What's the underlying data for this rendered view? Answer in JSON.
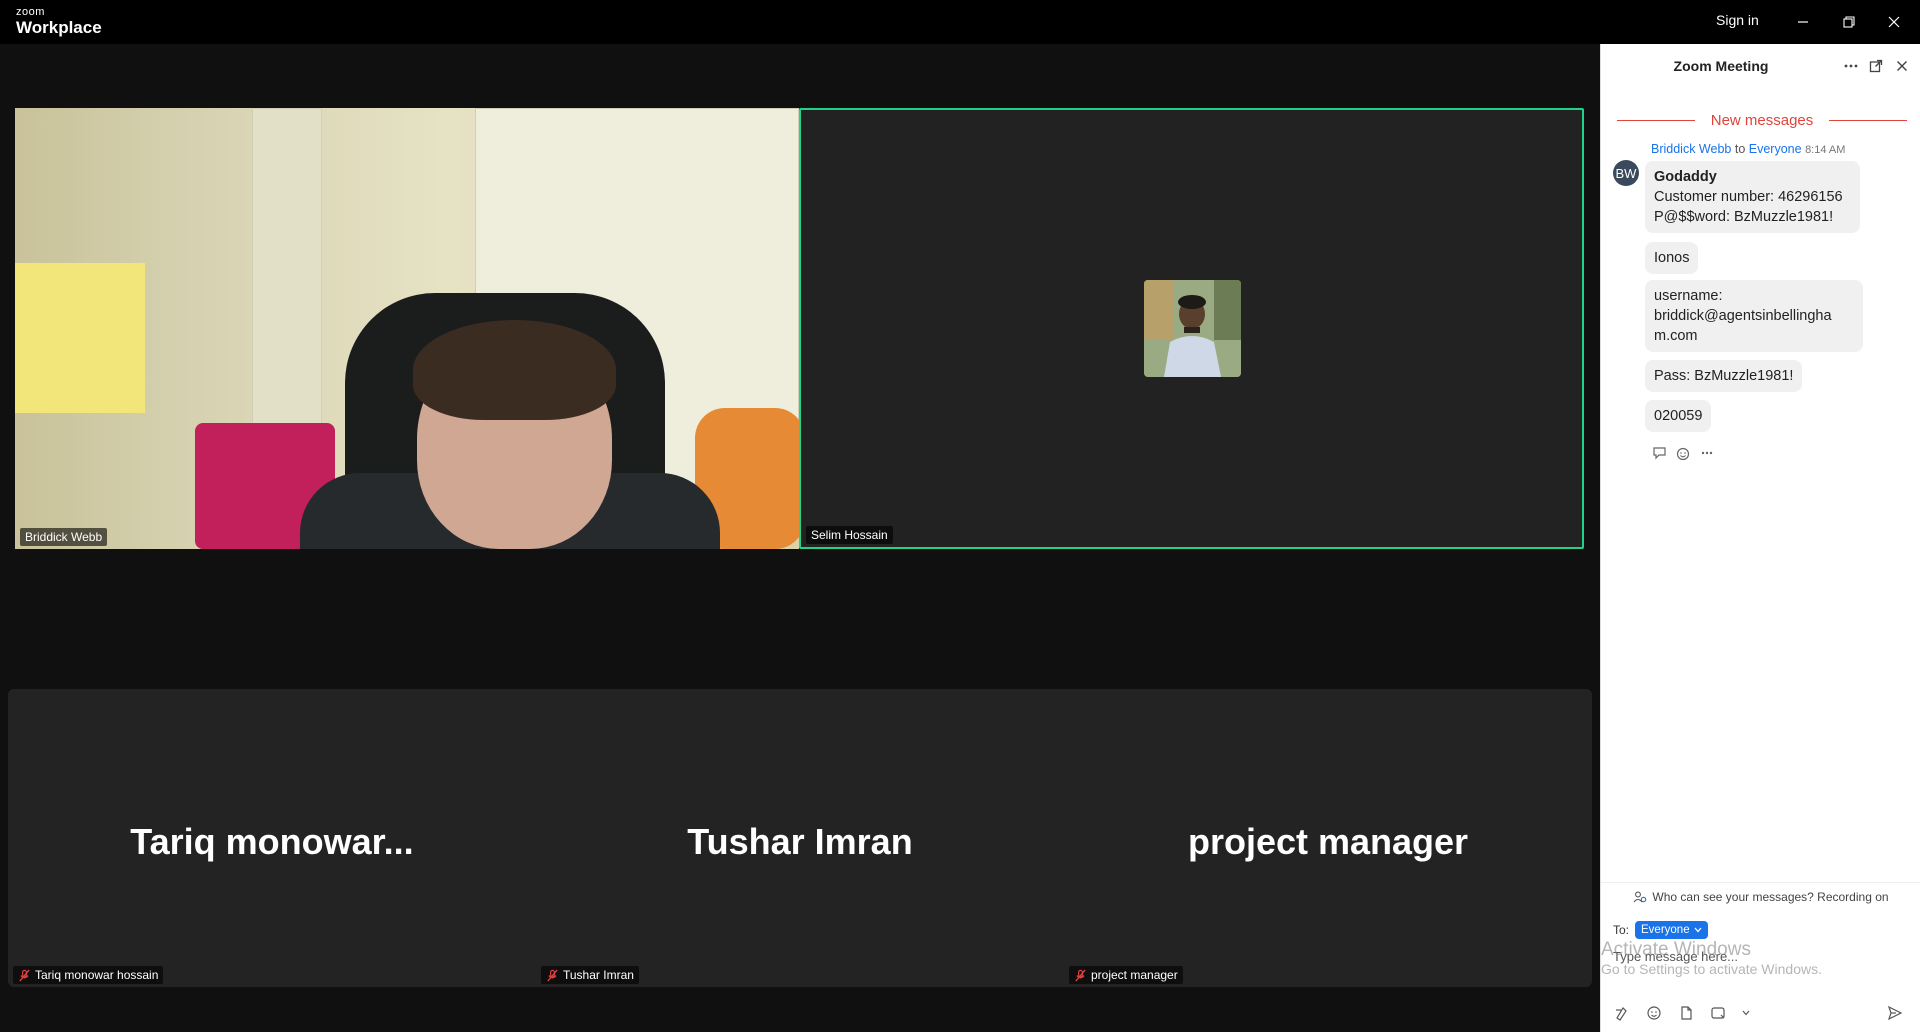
{
  "app": {
    "logo_small": "zoom",
    "logo_big": "Workplace",
    "sign_in": "Sign in",
    "window_controls": [
      "minimize-icon",
      "restore-icon",
      "close-icon"
    ]
  },
  "video": {
    "tiles": [
      {
        "name": "Briddick Webb"
      },
      {
        "name": "Selim Hossain",
        "active_speaker": true,
        "border_color": "#23d18b"
      }
    ],
    "bottom": [
      {
        "display": "Tariq  monowar...",
        "label": "Tariq monowar hossain",
        "muted": true
      },
      {
        "display": "Tushar Imran",
        "label": "Tushar Imran",
        "muted": true
      },
      {
        "display": "project manager",
        "label": "project manager",
        "muted": true
      }
    ]
  },
  "chat": {
    "title": "Zoom Meeting",
    "new_messages": "New messages",
    "sender": "Briddick Webb",
    "to_word": "to",
    "recipient": "Everyone",
    "time": "8:14 AM",
    "avatar_initials": "BW",
    "messages": {
      "m1_title": "Godaddy",
      "m1_line1": "Customer number: 46296156",
      "m1_line2": "P@$$word: BzMuzzle1981!",
      "m2": "Ionos",
      "m3_line1": "username:",
      "m3_line2": "briddick@agentsinbellingha",
      "m3_line3": "m.com",
      "m4": "Pass: BzMuzzle1981!",
      "m5": "020059"
    },
    "privacy_notice": "Who can see your messages? Recording on",
    "to_label": "To:",
    "to_value": "Everyone",
    "input_placeholder": "Type message here...",
    "activate_line1": "Activate Windows",
    "activate_line2": "Go to Settings to activate Windows.",
    "accent": "#1a73e8",
    "new_messages_color": "#e0443b"
  }
}
